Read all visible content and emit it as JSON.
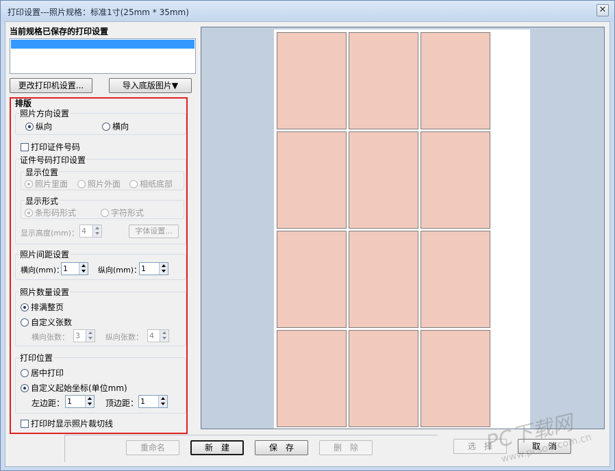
{
  "window": {
    "title": "打印设置---照片规格：标准1寸(25mm * 35mm)",
    "close_glyph": "✕"
  },
  "saved": {
    "title": "当前规格已保存的打印设置"
  },
  "buttons": {
    "change_printer": "更改打印机设置...",
    "import_base": "导入底版图片▼",
    "rename": "重命名",
    "new": "新　建",
    "save": "保　存",
    "delete": "删　除",
    "select": "选　择",
    "cancel": "取　消"
  },
  "layout": {
    "title": "排版",
    "orientation": {
      "title": "照片方向设置",
      "portrait": "纵向",
      "landscape": "横向",
      "selected": "portrait"
    },
    "print_id": {
      "label": "打印证件号码",
      "checked": false
    },
    "id_print": {
      "title": "证件号码打印设置",
      "position": {
        "title": "显示位置",
        "inside": "照片里面",
        "outside": "照片外面",
        "bottom": "相纸底部"
      },
      "form": {
        "title": "显示形式",
        "barcode": "条形码形式",
        "text": "字符形式"
      },
      "height_label": "显示高度(mm)：",
      "height_value": "4",
      "font_button": "字体设置..."
    },
    "spacing": {
      "title": "照片间距设置",
      "h_label": "横向(mm)：",
      "h_value": "1",
      "v_label": "纵向(mm)：",
      "v_value": "1"
    },
    "count": {
      "title": "照片数量设置",
      "fill": "排满整页",
      "custom": "自定义张数",
      "h_label": "横向张数：",
      "h_value": "3",
      "v_label": "纵向张数：",
      "v_value": "4"
    },
    "print_pos": {
      "title": "打印位置",
      "center": "居中打印",
      "custom": "自定义起始坐标(单位mm)",
      "left_label": "左边距：",
      "left_value": "1",
      "top_label": "顶边距：",
      "top_value": "1"
    },
    "cut_lines": {
      "label": "打印时显示照片裁切线",
      "checked": false
    }
  },
  "preview": {
    "columns": 3,
    "rows": 4
  },
  "colors": {
    "photo": "#f2c9bd",
    "preview_bg": "#c1cfde",
    "highlight": "#e02020",
    "selection": "#3399ff"
  },
  "watermark": {
    "text": "PC下载网",
    "url": "www.pcsoft.com.cn"
  }
}
